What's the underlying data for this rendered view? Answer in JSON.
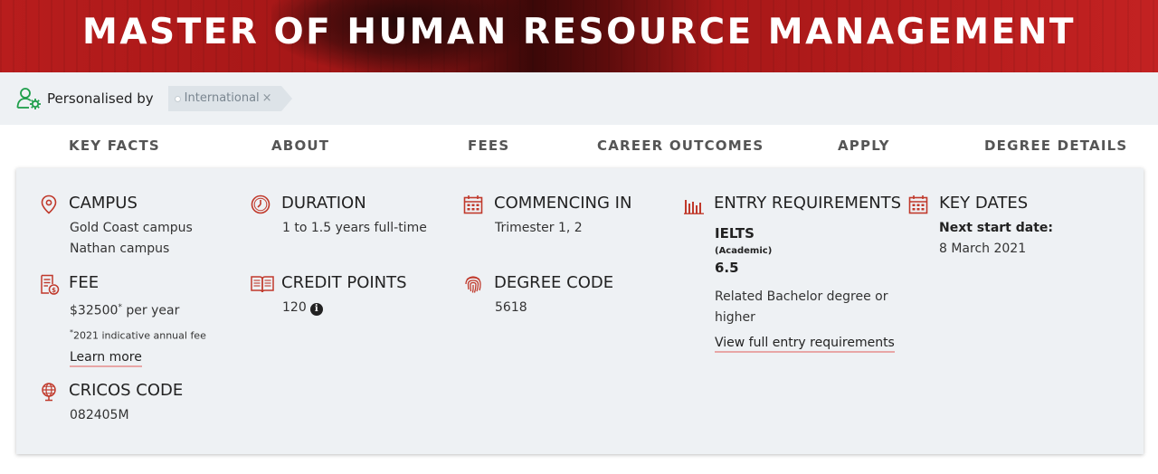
{
  "hero": {
    "title": "MASTER OF HUMAN RESOURCE MANAGEMENT"
  },
  "personalised": {
    "label": "Personalised by",
    "chip_label": "International",
    "chip_remove": "×"
  },
  "nav": {
    "tabs": [
      "KEY FACTS",
      "ABOUT",
      "FEES",
      "CAREER OUTCOMES",
      "APPLY",
      "DEGREE DETAILS"
    ]
  },
  "facts": {
    "campus": {
      "title": "CAMPUS",
      "lines": [
        "Gold Coast campus",
        "Nathan campus"
      ]
    },
    "duration": {
      "title": "DURATION",
      "value": "1 to 1.5 years full-time"
    },
    "commencing": {
      "title": "COMMENCING IN",
      "value": "Trimester 1, 2"
    },
    "entry": {
      "title": "ENTRY REQUIREMENTS",
      "test": "IELTS",
      "test_type": "(Academic)",
      "score": "6.5",
      "related": "Related Bachelor degree or",
      "related2": "higher",
      "link": "View full entry requirements"
    },
    "key_dates": {
      "title": "KEY DATES",
      "label": "Next start date:",
      "value": "8 March 2021"
    },
    "fee": {
      "title": "FEE",
      "amount": "$32500",
      "asterisk": "*",
      "period": " per year",
      "note_star": "*",
      "note": "2021 indicative annual fee",
      "link": "Learn more"
    },
    "credit_points": {
      "title": "CREDIT POINTS",
      "value": "120",
      "info_glyph": "i"
    },
    "degree_code": {
      "title": "DEGREE CODE",
      "value": "5618"
    },
    "cricos": {
      "title": "CRICOS CODE",
      "value": "082405M"
    }
  },
  "colors": {
    "accent": "#c8102e",
    "icon_red": "#c0392b",
    "icon_green": "#1e9e4a",
    "panel_bg": "#eef1f4"
  },
  "icons": [
    "user-settings-icon",
    "location-pin-icon",
    "clock-icon",
    "calendar-icon",
    "bar-chart-icon",
    "fee-receipt-icon",
    "book-icon",
    "fingerprint-icon",
    "globe-icon",
    "info-icon"
  ]
}
